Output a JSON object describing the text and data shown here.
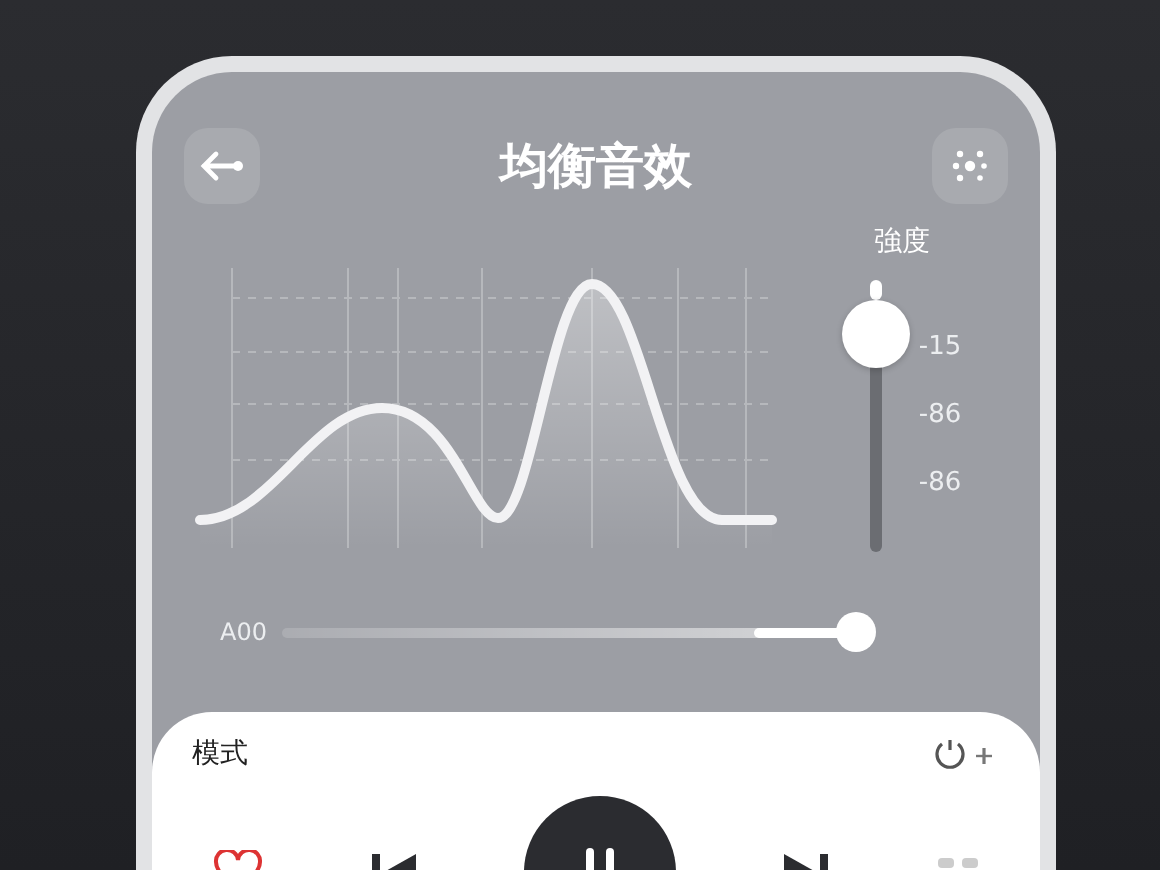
{
  "header": {
    "title": "均衡音效"
  },
  "strength": {
    "label": "強度",
    "level": 0.8,
    "ticks": [
      "-15",
      "-86",
      "-86"
    ]
  },
  "balance": {
    "label": "A00",
    "level": 1
  },
  "mode": {
    "label": "模式"
  }
}
